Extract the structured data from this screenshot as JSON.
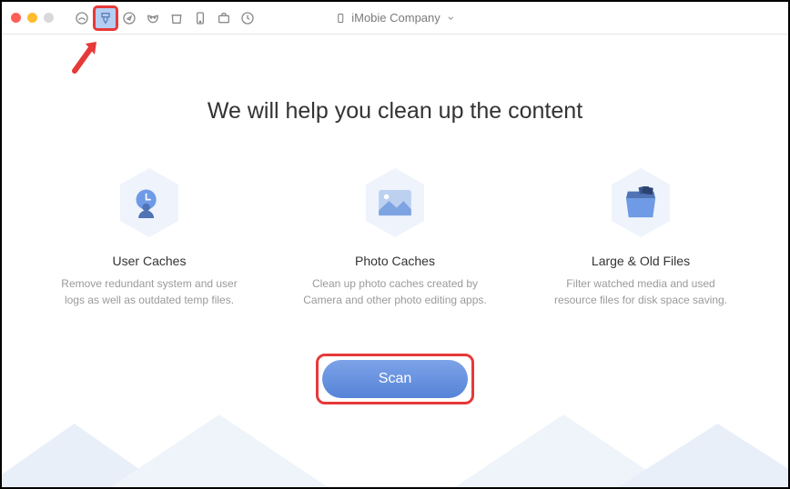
{
  "titlebar": {
    "device_name": "iMobie Company"
  },
  "toolbar": {
    "icons": [
      "home",
      "brush",
      "compass",
      "mask",
      "trash",
      "mobile",
      "briefcase",
      "clock"
    ]
  },
  "main": {
    "heading": "We will help you clean up the content"
  },
  "features": [
    {
      "title": "User Caches",
      "desc": "Remove redundant system and user logs as well as outdated temp files."
    },
    {
      "title": "Photo Caches",
      "desc": "Clean up photo caches created by Camera and other photo editing apps."
    },
    {
      "title": "Large & Old Files",
      "desc": "Filter watched media and used resource files for disk space saving."
    }
  ],
  "scan": {
    "label": "Scan"
  }
}
